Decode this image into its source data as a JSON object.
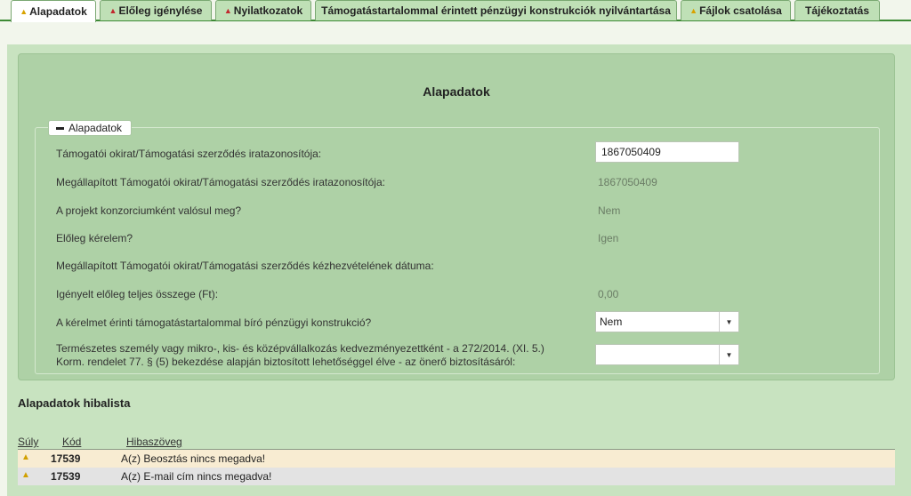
{
  "tabs": [
    {
      "label": "Alapadatok",
      "warn": "yellow"
    },
    {
      "label": "Előleg igénylése",
      "warn": "red"
    },
    {
      "label": "Nyilatkozatok",
      "warn": "red"
    },
    {
      "label": "Támogatástartalommal érintett pénzügyi konstrukciók nyilvántartása",
      "warn": ""
    },
    {
      "label": "Fájlok csatolása",
      "warn": "yellow"
    },
    {
      "label": "Tájékoztatás",
      "warn": ""
    }
  ],
  "panel": {
    "title": "Alapadatok",
    "legend": "Alapadatok",
    "fields": {
      "okirat_label": "Támogatói okirat/Támogatási szerződés iratazonosítója:",
      "okirat_value": "1867050409",
      "megallapitott_label": "Megállapított Támogatói okirat/Támogatási szerződés iratazonosítója:",
      "megallapitott_value": "1867050409",
      "konzorcium_label": "A projekt konzorciumként valósul meg?",
      "konzorcium_value": "Nem",
      "eloleg_label": "Előleg kérelem?",
      "eloleg_value": "Igen",
      "kezhez_label": "Megállapított Támogatói okirat/Támogatási szerződés kézhezvételének dátuma:",
      "osszeg_label": "Igényelt előleg teljes összege (Ft):",
      "osszeg_value": "0,00",
      "konstrukcio_label": "A kérelmet érinti támogatástartalommal bíró pénzügyi konstrukció?",
      "konstrukcio_value": "Nem",
      "kkv_label_1": "Természetes személy vagy mikro-, kis- és középvállalkozás kedvezményezettként - a 272/2014. (XI. 5.)",
      "kkv_label_2": "Korm. rendelet 77. § (5) bekezdése alapján biztosított lehetőséggel élve - az önerő biztosításáról:",
      "kkv_value": ""
    }
  },
  "errors": {
    "title": "Alapadatok hibalista",
    "headers": {
      "suly": "Súly",
      "kod": "Kód",
      "hiba": "Hibaszöveg"
    },
    "rows": [
      {
        "code": "17539",
        "text": "A(z) Beosztás nincs megadva!"
      },
      {
        "code": "17539",
        "text": "A(z) E-mail cím nincs megadva!"
      }
    ]
  },
  "colors": {
    "accent": "#3d8a35",
    "panel": "#aed1a6",
    "warn_yellow": "#d8a200",
    "warn_red": "#c1272d"
  },
  "icons": {
    "tab_warn": "warning-triangle-icon",
    "select": "chevron-down-icon",
    "legend": "collapse-minus-icon"
  }
}
